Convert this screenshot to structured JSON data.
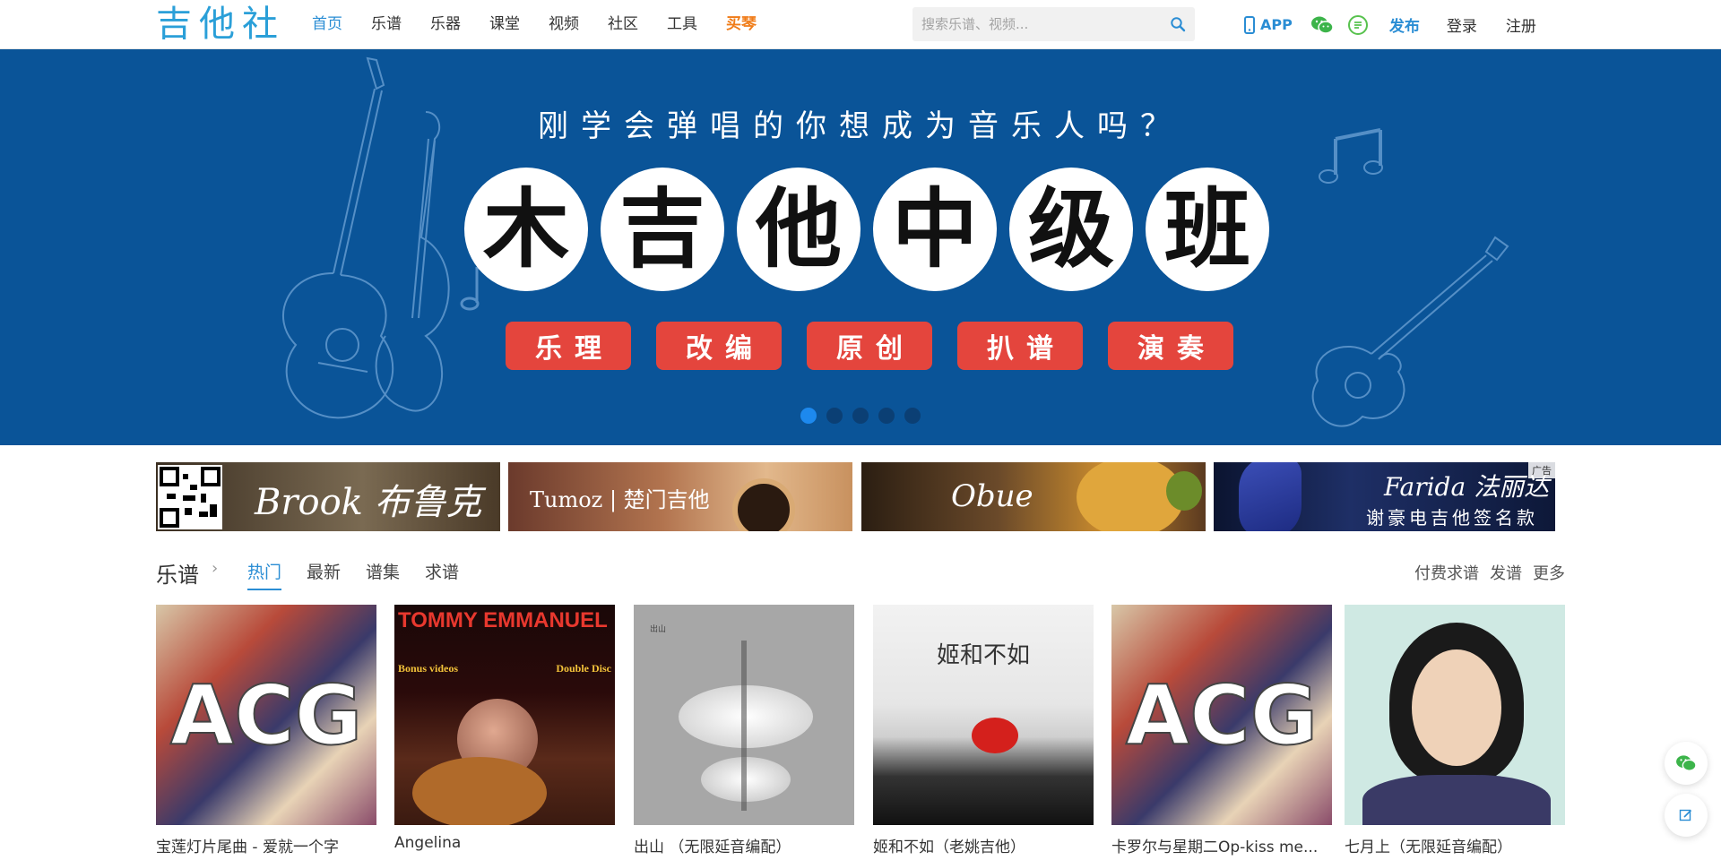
{
  "header": {
    "logo": "吉他社",
    "nav": [
      {
        "label": "首页",
        "state": "active"
      },
      {
        "label": "乐谱",
        "state": ""
      },
      {
        "label": "乐器",
        "state": ""
      },
      {
        "label": "课堂",
        "state": ""
      },
      {
        "label": "视频",
        "state": ""
      },
      {
        "label": "社区",
        "state": ""
      },
      {
        "label": "工具",
        "state": ""
      },
      {
        "label": "买琴",
        "state": "hot"
      }
    ],
    "search_placeholder": "搜索乐谱、视频...",
    "app_label": "APP",
    "publish_label": "发布",
    "login_label": "登录",
    "register_label": "注册",
    "icons": [
      "phone-icon",
      "wechat-icon",
      "weibo-icon",
      "search-icon"
    ]
  },
  "banner": {
    "headline": "刚学会弹唱的你想成为音乐人吗？",
    "characters": [
      "木",
      "吉",
      "他",
      "中",
      "级",
      "班"
    ],
    "tags": [
      "乐理",
      "改编",
      "原创",
      "扒谱",
      "演奏"
    ],
    "slide_count": 5,
    "active_slide": 1,
    "bg_color": "#0a5498",
    "tag_color": "#e4453d"
  },
  "ads": [
    {
      "text": "Brook 布鲁克"
    },
    {
      "text": "Tumoz | 楚门吉他"
    },
    {
      "text": "Obue"
    },
    {
      "text": "Farida 法丽达",
      "sub": "谢豪电吉他签名款",
      "badge": "广告"
    }
  ],
  "section": {
    "title": "乐谱",
    "tabs": [
      {
        "label": "热门",
        "state": "active"
      },
      {
        "label": "最新",
        "state": ""
      },
      {
        "label": "谱集",
        "state": ""
      },
      {
        "label": "求谱",
        "state": ""
      }
    ],
    "links": [
      "付费求谱",
      "发谱",
      "更多"
    ]
  },
  "cards": [
    {
      "title": "宝莲灯片尾曲 - 爱就一个字",
      "cover_text": "ACG"
    },
    {
      "title": "Angelina",
      "cover_text": "TOMMY EMMANUEL",
      "cover_sub1": "Bonus videos",
      "cover_sub2": "Double Disc"
    },
    {
      "title": "出山 （无限延音编配）",
      "cover_text": "出山"
    },
    {
      "title": "姬和不如（老姚吉他）",
      "cover_text": "姬和不如"
    },
    {
      "title": "卡罗尔与星期二Op-kiss me...",
      "cover_text": "ACG"
    },
    {
      "title": "七月上（无限延音编配）",
      "cover_text": ""
    }
  ]
}
